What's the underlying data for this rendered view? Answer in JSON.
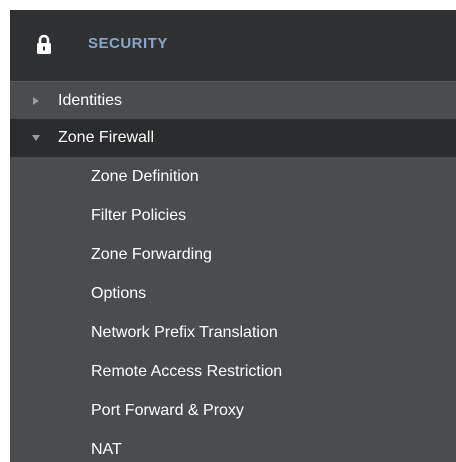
{
  "header": {
    "title": "SECURITY",
    "icon": "lock-icon",
    "title_color": "#8ba7c7",
    "background": "#2f3133"
  },
  "menu": {
    "items": [
      {
        "label": "Identities",
        "state": "collapsed",
        "icon": "caret-right-icon"
      },
      {
        "label": "Zone Firewall",
        "state": "expanded",
        "icon": "caret-down-icon",
        "children": [
          {
            "label": "Zone Definition"
          },
          {
            "label": "Filter Policies"
          },
          {
            "label": "Zone Forwarding"
          },
          {
            "label": "Options"
          },
          {
            "label": "Network Prefix Translation"
          },
          {
            "label": "Remote Access Restriction"
          },
          {
            "label": "Port Forward & Proxy"
          },
          {
            "label": "NAT"
          }
        ]
      }
    ]
  },
  "colors": {
    "panel_background": "#4a4d50",
    "expanded_row_background": "#2a2c2e",
    "text": "#ffffff",
    "arrow": "#9a9c9e"
  }
}
